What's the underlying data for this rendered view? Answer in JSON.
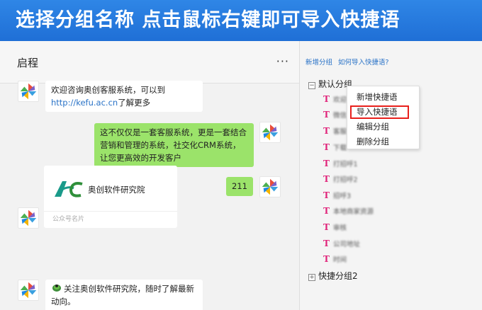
{
  "banner": {
    "text": "选择分组名称   点击鼠标右键即可导入快捷语"
  },
  "chat": {
    "title": "启程",
    "more_label": "···",
    "messages": [
      {
        "text_pre": "欢迎咨询奥创客服系统，可以到",
        "link": "http://kefu.ac.cn",
        "text_post": "了解更多"
      },
      {
        "text": "这不仅仅是一套客服系统，更是一套结合营销和管理的系统，社交化CRM系统，让您更高效的开发客户"
      },
      {
        "text": "211"
      },
      {
        "card_name": "奥创软件研究院",
        "card_foot": "公众号名片"
      },
      {
        "text": "关注奥创软件研究院，随时了解最新动向。"
      }
    ]
  },
  "panel": {
    "links": [
      "新增分组",
      "如何导入快捷语?"
    ],
    "group1": {
      "toggle": "−",
      "name": "默认分组"
    },
    "items": [
      "欢迎",
      "微信",
      "客服",
      "下载",
      "打招呼1",
      "打招呼2",
      "招呼3",
      "本地商家资源",
      "审核",
      "公司地址",
      "时间"
    ],
    "group2": {
      "toggle": "+",
      "name": "快捷分组2"
    },
    "item_icon": "T"
  },
  "context_menu": {
    "items": [
      "新增快捷语",
      "导入快捷语",
      "编辑分组",
      "删除分组"
    ],
    "highlighted": "导入快捷语"
  },
  "colors": {
    "banner": "#1f6fd6",
    "bubble_right": "#9be36a",
    "link": "#2a73c7",
    "t_icon": "#e0247a",
    "highlight": "#e8201c"
  }
}
